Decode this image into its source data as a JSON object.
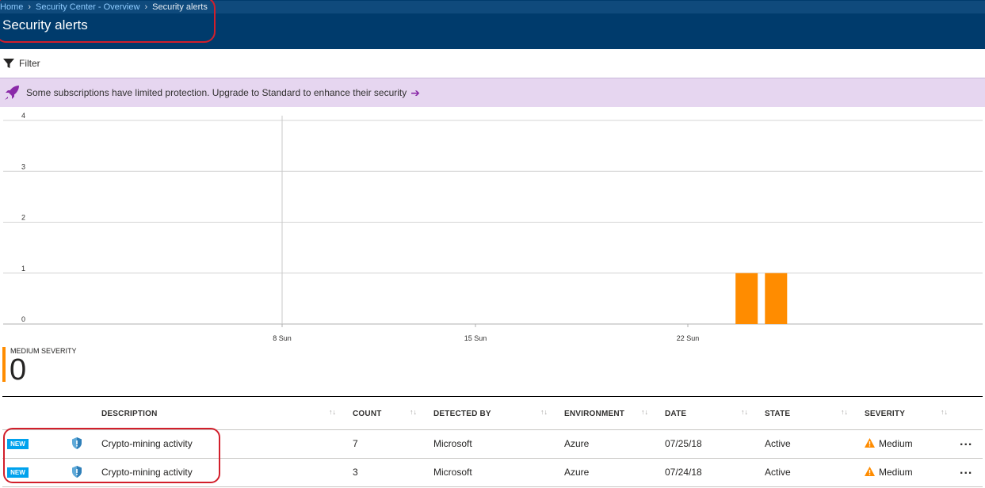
{
  "breadcrumb": [
    "Home",
    "Security Center - Overview",
    "Security alerts"
  ],
  "page_title": "Security alerts",
  "toolbar": {
    "filter_label": "Filter"
  },
  "banner": {
    "message": "Some subscriptions have limited protection. Upgrade to Standard to enhance their security",
    "arrow": "➔"
  },
  "chart_data": {
    "type": "bar",
    "yticks": [
      "0",
      "1",
      "2",
      "3",
      "4"
    ],
    "xticks": [
      "8 Sun",
      "15 Sun",
      "22 Sun"
    ],
    "ylim": [
      0,
      4
    ],
    "series": [
      {
        "values": [
          {
            "date": "07/24/18",
            "value": 1
          },
          {
            "date": "07/25/18",
            "value": 1
          }
        ]
      }
    ],
    "bar_color": "#ff8c00",
    "grid": true
  },
  "severity_summary": {
    "label": "MEDIUM SEVERITY",
    "count": "0",
    "color": "#ff8c00"
  },
  "table": {
    "columns": [
      "DESCRIPTION",
      "COUNT",
      "DETECTED BY",
      "ENVIRONMENT",
      "DATE",
      "STATE",
      "SEVERITY"
    ],
    "sort_icon": "↑↓",
    "rows": [
      {
        "badge": "NEW",
        "icon": "shield-icon",
        "description": "Crypto-mining activity",
        "count": "7",
        "detected_by": "Microsoft",
        "environment": "Azure",
        "date": "07/25/18",
        "state": "Active",
        "severity": "Medium"
      },
      {
        "badge": "NEW",
        "icon": "shield-icon",
        "description": "Crypto-mining activity",
        "count": "3",
        "detected_by": "Microsoft",
        "environment": "Azure",
        "date": "07/24/18",
        "state": "Active",
        "severity": "Medium"
      }
    ],
    "more_label": "..."
  }
}
